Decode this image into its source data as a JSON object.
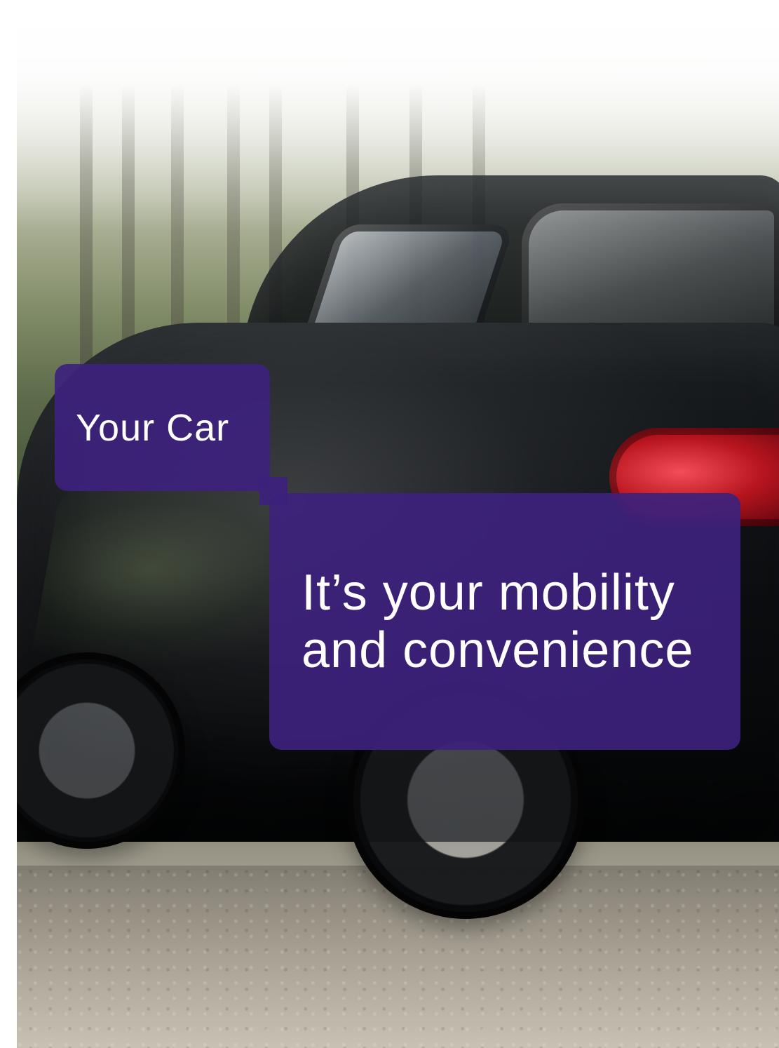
{
  "headline": {
    "small_label": "Your Car",
    "large_line_1": "It’s your mobility",
    "large_line_2": "and convenience"
  },
  "colors": {
    "panel_purple": "#3D227D",
    "text": "#FFFFFF"
  }
}
